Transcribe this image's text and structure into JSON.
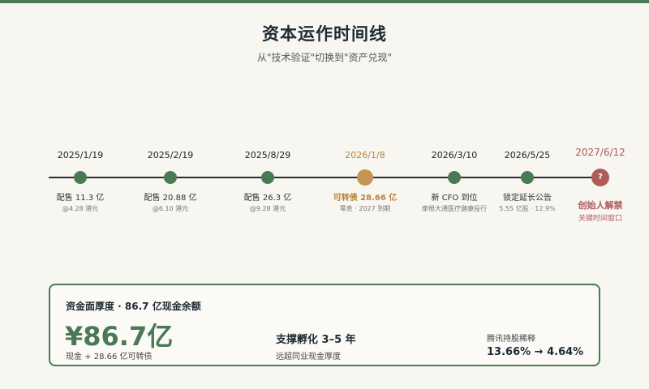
{
  "title": "资本运作时间线",
  "subtitle": "从\"技术验证\"切换到\"资产兑现\"",
  "timeline": [
    {
      "date": "2025/1/19",
      "label": "配售 11.3 亿",
      "sub": "@4.28 港元",
      "status": "done"
    },
    {
      "date": "2025/2/19",
      "label": "配售 20.88 亿",
      "sub": "@6.10 港元",
      "status": "done"
    },
    {
      "date": "2025/8/29",
      "label": "配售 26.3 亿",
      "sub": "@9.28 港元",
      "status": "done"
    },
    {
      "date": "2026/1/8",
      "label": "可转债 28.66 亿",
      "sub": "零息 · 2027 到期",
      "status": "highlight"
    },
    {
      "date": "2026/3/10",
      "label": "新 CFO 到位",
      "sub": "摩根大通医疗健康投行",
      "status": "done"
    },
    {
      "date": "2026/5/25",
      "label": "锁定延长公告",
      "sub": "5.55 亿股 · 12.9%",
      "status": "done"
    },
    {
      "date": "2027/6/12",
      "label": "创始人解禁",
      "sub": "关键时间窗口",
      "marker": "?",
      "status": "key"
    }
  ],
  "colors": {
    "accent": "#4a7a55",
    "highlight": "#c49555",
    "key": "#b05a5a"
  },
  "summary": {
    "heading": "资金面厚度 · 86.7 亿现金余额",
    "amount": "¥86.7亿",
    "amount_note": "现金 + 28.66 亿可转债",
    "mid_title": "支撑孵化 3–5 年",
    "mid_sub": "远超同业现金厚度",
    "right_label": "腾讯持股稀释",
    "right_value": "13.66% → 4.64%"
  }
}
